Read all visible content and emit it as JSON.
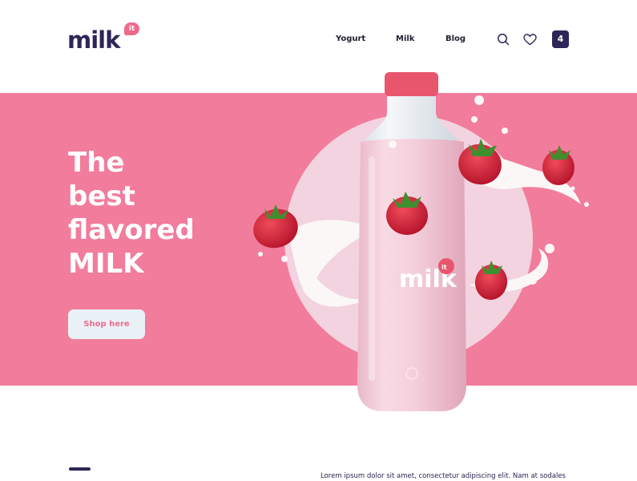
{
  "brand": {
    "logo_text": "milk",
    "logo_badge": "it",
    "accent_color": "#f27c9b",
    "dark_color": "#2d2657"
  },
  "nav": {
    "items": [
      {
        "label": "Yogurt"
      },
      {
        "label": "Milk"
      },
      {
        "label": "Blog"
      }
    ],
    "icons": [
      "search-icon",
      "heart-icon"
    ],
    "cart_count": "4"
  },
  "hero": {
    "title_lines": [
      "The",
      "best",
      "flavored",
      "MILK"
    ],
    "cta_label": "Shop here",
    "bottle_label": "milk",
    "bottle_badge": "it"
  },
  "intro": {
    "text": "Lorem ipsum dolor sit amet, consectetur adipiscing elit. Nam at sodales"
  }
}
